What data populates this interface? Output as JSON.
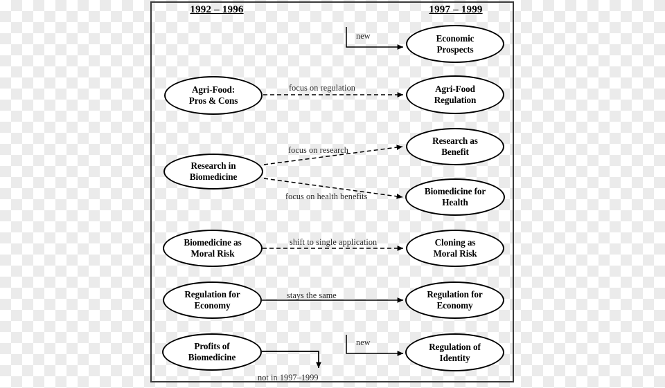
{
  "diagram": {
    "headers": {
      "left": "1992 – 1996",
      "right": "1997 – 1999"
    },
    "left_nodes": [
      {
        "id": "agri-food-pros-cons",
        "line1": "Agri-Food:",
        "line2": "Pros & Cons"
      },
      {
        "id": "research-in-biomedicine",
        "line1": "Research in",
        "line2": "Biomedicine"
      },
      {
        "id": "biomedicine-moral-risk",
        "line1": "Biomedicine as",
        "line2": "Moral Risk"
      },
      {
        "id": "regulation-for-economy-left",
        "line1": "Regulation for",
        "line2": "Economy"
      },
      {
        "id": "profits-of-biomedicine",
        "line1": "Profits of",
        "line2": "Biomedicine"
      }
    ],
    "right_nodes": [
      {
        "id": "economic-prospects",
        "line1": "Economic",
        "line2": "Prospects"
      },
      {
        "id": "agri-food-regulation",
        "line1": "Agri-Food",
        "line2": "Regulation"
      },
      {
        "id": "research-as-benefit",
        "line1": "Research as",
        "line2": "Benefit"
      },
      {
        "id": "biomedicine-for-health",
        "line1": "Biomedicine for",
        "line2": "Health"
      },
      {
        "id": "cloning-as-moral-risk",
        "line1": "Cloning as",
        "line2": "Moral Risk"
      },
      {
        "id": "regulation-for-economy-right",
        "line1": "Regulation for",
        "line2": "Economy"
      },
      {
        "id": "regulation-of-identity",
        "line1": "Regulation of",
        "line2": "Identity"
      }
    ],
    "edge_labels": {
      "new_top": "new",
      "focus_on_regulation": "focus on regulation",
      "focus_on_research": "focus on research",
      "focus_on_health_benefits": "focus on health benefits",
      "shift_to_single_application": "shift to single application",
      "stays_the_same": "stays the same",
      "new_bottom": "new",
      "not_in_period": "not in 1997–1999"
    },
    "colors": {
      "stroke": "#000000",
      "frame": "#3a3a3a",
      "node_fill": "#ffffff",
      "label_text": "#2a2a2a"
    }
  }
}
